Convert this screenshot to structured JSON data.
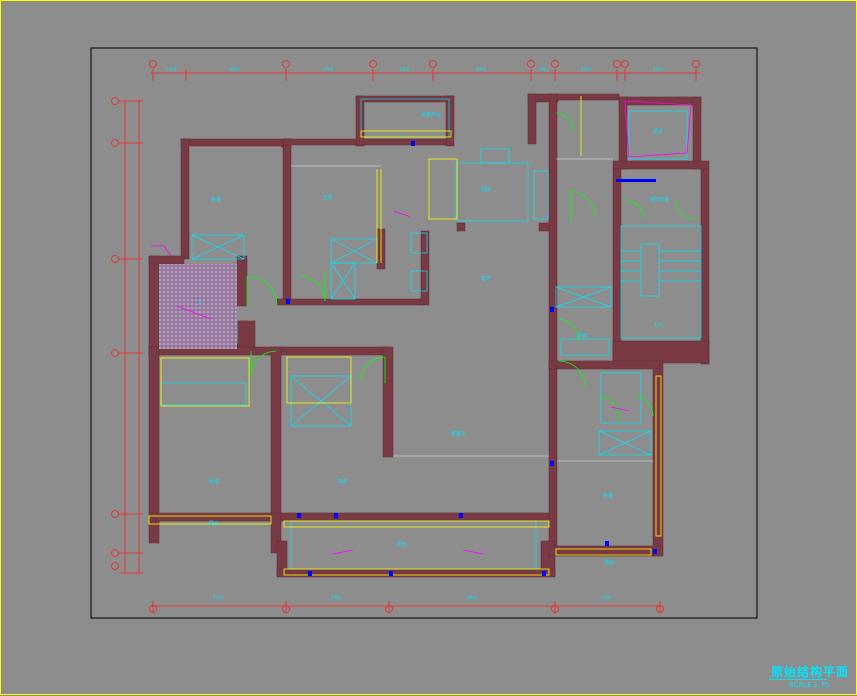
{
  "drawing": {
    "title": "原始结构平面",
    "scale": "SCALE 1:75"
  },
  "rooms": [
    {
      "key": "balcony_top",
      "label": "设备平台"
    },
    {
      "key": "kitchen",
      "label": "厨房"
    },
    {
      "key": "shaft",
      "label": "风井"
    },
    {
      "key": "fire_room",
      "label": "消防前室"
    },
    {
      "key": "stair",
      "label": "LT1"
    },
    {
      "key": "bedroom_tl",
      "label": "卧室"
    },
    {
      "key": "master_bed",
      "label": "主卧"
    },
    {
      "key": "living",
      "label": "客厅"
    },
    {
      "key": "wc",
      "label": "卫"
    },
    {
      "key": "corridor",
      "label": "走廊"
    },
    {
      "key": "hall",
      "label": "客餐厅"
    },
    {
      "key": "bed_bl",
      "label": "卧室"
    },
    {
      "key": "study",
      "label": "书房"
    },
    {
      "key": "bed_r",
      "label": "卧室"
    },
    {
      "key": "veranda",
      "label": "阳台"
    },
    {
      "key": "balcony_s",
      "label": "阳台"
    },
    {
      "key": "balcony_r",
      "label": "阳台"
    }
  ],
  "colors": {
    "background": "#8d8d8d",
    "wall": "#7a3a44",
    "dimension": "#ff2020",
    "fixture": "#00e5ff",
    "door": "#00ff00",
    "window": "#ffff00",
    "structure": "#ff00ff"
  }
}
